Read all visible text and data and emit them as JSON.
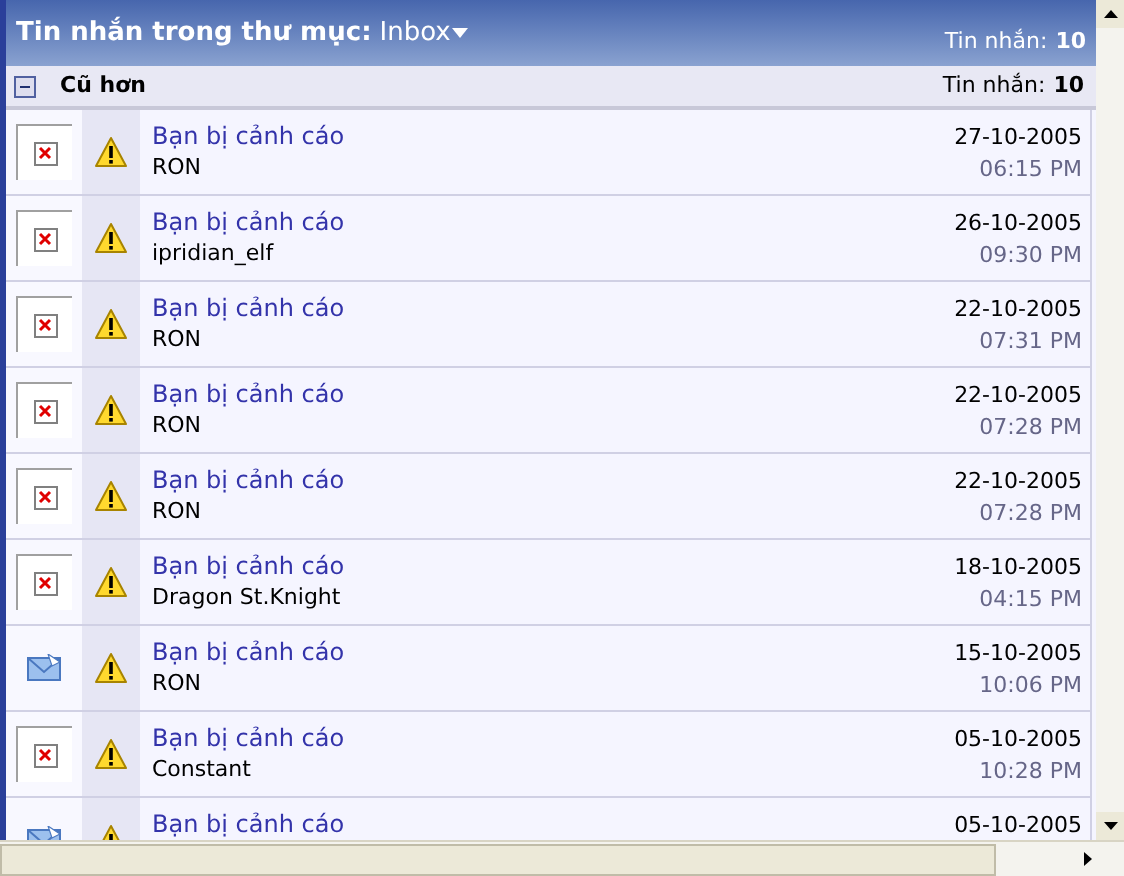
{
  "header": {
    "title": "Tin nhắn trong thư mục:",
    "folder": "Inbox",
    "count_label": "Tin nhắn:",
    "count": "10"
  },
  "group": {
    "label": "Cũ hơn",
    "expanded": true,
    "count_label": "Tin nhắn:",
    "count": "10"
  },
  "messages": [
    {
      "kind": "broken-image",
      "subject": "Bạn bị cảnh cáo",
      "sender": "RON",
      "date": "27-10-2005",
      "time": "06:15 PM"
    },
    {
      "kind": "broken-image",
      "subject": "Bạn bị cảnh cáo",
      "sender": "ipridian_elf",
      "date": "26-10-2005",
      "time": "09:30 PM"
    },
    {
      "kind": "broken-image",
      "subject": "Bạn bị cảnh cáo",
      "sender": "RON",
      "date": "22-10-2005",
      "time": "07:31 PM"
    },
    {
      "kind": "broken-image",
      "subject": "Bạn bị cảnh cáo",
      "sender": "RON",
      "date": "22-10-2005",
      "time": "07:28 PM"
    },
    {
      "kind": "broken-image",
      "subject": "Bạn bị cảnh cáo",
      "sender": "RON",
      "date": "22-10-2005",
      "time": "07:28 PM"
    },
    {
      "kind": "broken-image",
      "subject": "Bạn bị cảnh cáo",
      "sender": "Dragon St.Knight",
      "date": "18-10-2005",
      "time": "04:15 PM"
    },
    {
      "kind": "envelope",
      "subject": "Bạn bị cảnh cáo",
      "sender": "RON",
      "date": "15-10-2005",
      "time": "10:06 PM"
    },
    {
      "kind": "broken-image",
      "subject": "Bạn bị cảnh cáo",
      "sender": "Constant",
      "date": "05-10-2005",
      "time": "10:28 PM"
    },
    {
      "kind": "envelope",
      "subject": "Bạn bị cảnh cáo",
      "date": "05-10-2005"
    }
  ]
}
